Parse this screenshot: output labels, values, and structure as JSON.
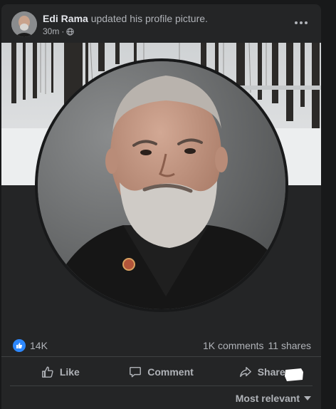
{
  "post": {
    "author": "Edi Rama",
    "action": "updated his profile picture.",
    "time": "30m",
    "dot": "·",
    "audience_icon": "globe-icon",
    "menu_icon": "more-horizontal-icon"
  },
  "stats": {
    "reaction_icon": "like-reaction-icon",
    "reactions_count": "14K",
    "comments": "1K comments",
    "shares": "11 shares"
  },
  "actions": {
    "like": "Like",
    "comment": "Comment",
    "share": "Share"
  },
  "comments_filter": {
    "label": "Most relevant"
  },
  "colors": {
    "background": "#18191a",
    "card": "#242526",
    "text_primary": "#e4e6eb",
    "text_secondary": "#b0b3b8",
    "like_blue": "#2d88ff",
    "divider": "#3e4042"
  }
}
